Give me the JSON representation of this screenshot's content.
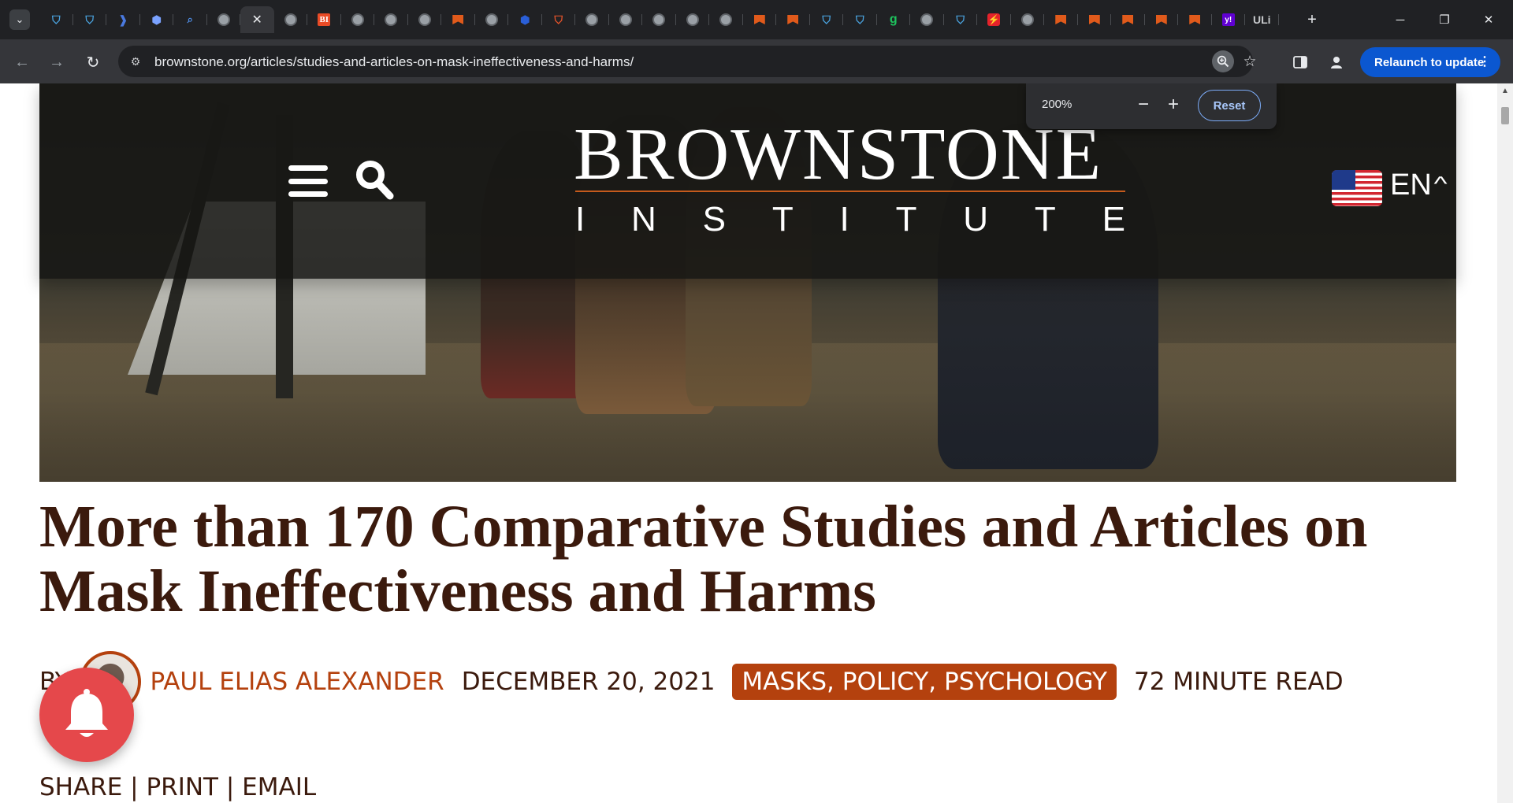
{
  "browser": {
    "tab_count": 37,
    "active_tab_index": 6,
    "url": "brownstone.org/articles/studies-and-articles-on-mask-ineffectiveness-and-harms/",
    "relaunch_label": "Relaunch to update",
    "new_tab_glyph": "+",
    "zoom_popup": {
      "level": "200%",
      "reset_label": "Reset"
    },
    "tab_favicons": [
      "shield-icon",
      "shield-icon",
      "dd-icon",
      "hex-icon",
      "search-icon",
      "globe-icon",
      "close-icon",
      "globe-icon",
      "bi-icon",
      "globe-icon",
      "globe-icon",
      "globe-icon",
      "brownstone-icon",
      "globe-icon",
      "cube-icon",
      "ublock-icon",
      "globe-icon",
      "globe-icon",
      "globe-icon",
      "globe-icon",
      "globe-icon",
      "brownstone-icon",
      "brownstone-icon",
      "shield-icon",
      "shield-icon",
      "g-icon",
      "globe-icon",
      "shield-icon",
      "red-icon",
      "globe-icon",
      "brownstone-icon",
      "brownstone-icon",
      "brownstone-icon",
      "brownstone-icon",
      "brownstone-icon",
      "yahoo-icon",
      "cap-icon"
    ],
    "bi_text": "BI",
    "g_text": "g",
    "yahoo_text": "y!",
    "cap_text": "ULi"
  },
  "site": {
    "logo_name": "BROWNSTONE",
    "logo_sub": [
      "I",
      "N",
      "S",
      "T",
      "I",
      "T",
      "U",
      "T",
      "E"
    ],
    "language": "EN"
  },
  "article": {
    "title": "More than 170 Comparative Studies and Articles on Mask Ineffectiveness and Harms",
    "by_label": "BY",
    "author": "PAUL ELIAS ALEXANDER",
    "date": "DECEMBER 20, 2021",
    "tags": "MASKS, POLICY, PSYCHOLOGY",
    "read_time": "72 MINUTE READ",
    "share": "SHARE",
    "print": "PRINT",
    "email": "EMAIL",
    "separator": " | "
  },
  "colors": {
    "accent": "#b4410e",
    "title": "#3b1a0d",
    "header_bg": "#161614",
    "relaunch": "#0b57d0",
    "bell": "#e5484b"
  }
}
